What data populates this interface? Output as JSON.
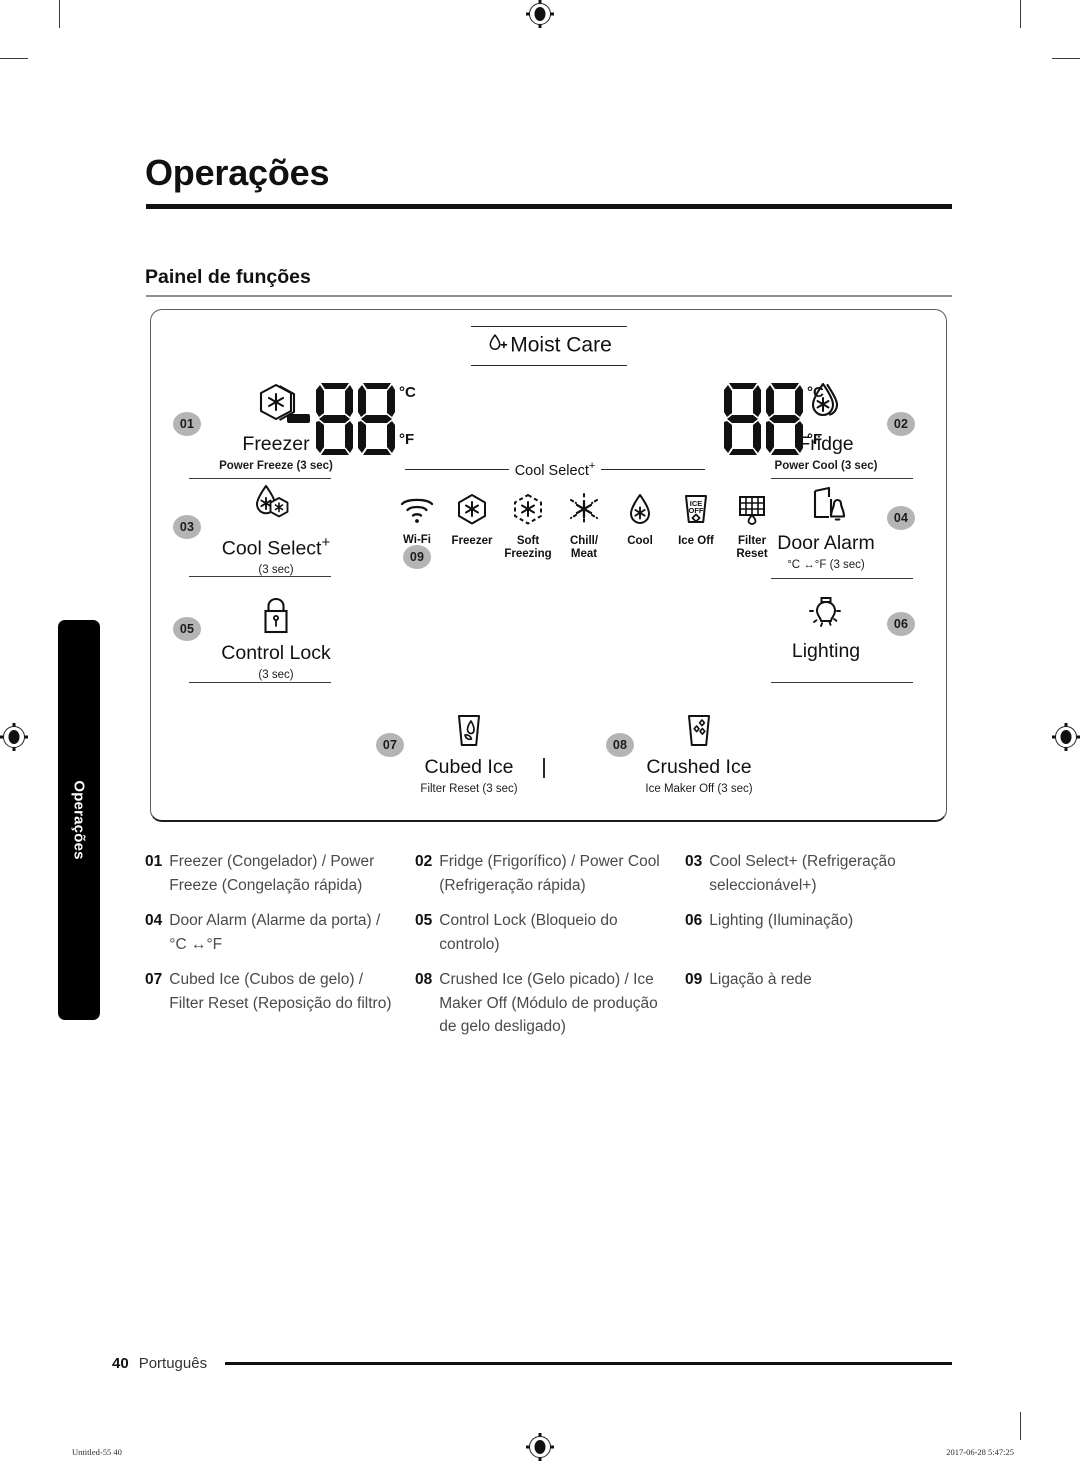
{
  "document": {
    "chapter_title": "Operações",
    "section_title": "Painel de funções",
    "side_tab_label": "Operações"
  },
  "panel": {
    "moist_care": {
      "label": "Moist Care",
      "icon": "water-drop-plus-icon"
    },
    "displays": [
      {
        "name": "freezer-temperature-display",
        "value": "88",
        "minus": "−",
        "unit_top": "°C",
        "unit_bottom": "°F"
      },
      {
        "name": "fridge-temperature-display",
        "value": "88",
        "minus": "",
        "unit_top": "°C",
        "unit_bottom": "°F"
      }
    ],
    "buttons": [
      {
        "id": "01",
        "name": "freezer-button",
        "icon": "hexagon-snowflake-icon",
        "title": "Freezer",
        "sub": "Power Freeze (3 sec)"
      },
      {
        "id": "02",
        "name": "fridge-button",
        "icon": "droplet-snowflake-icon",
        "title": "Fridge",
        "sub": "Power Cool (3 sec)"
      },
      {
        "id": "03",
        "name": "cool-select-plus-button",
        "icon": "droplet-snowflake-hexagon-icon",
        "title": "Cool Select",
        "title_sup": "+",
        "sub": "(3 sec)"
      },
      {
        "id": "04",
        "name": "door-alarm-button",
        "icon": "door-bell-icon",
        "title": "Door Alarm",
        "sub": "°C ↔°F (3 sec)"
      },
      {
        "id": "05",
        "name": "control-lock-button",
        "icon": "padlock-icon",
        "title": "Control Lock",
        "sub": "(3 sec)"
      },
      {
        "id": "06",
        "name": "lighting-button",
        "icon": "light-bulb-icon",
        "title": "Lighting",
        "sub": ""
      },
      {
        "id": "07",
        "name": "cubed-ice-button",
        "icon": "glass-cubed-ice-icon",
        "title": "Cubed Ice",
        "sub": "Filter Reset (3 sec)"
      },
      {
        "id": "08",
        "name": "crushed-ice-button",
        "icon": "glass-crushed-ice-icon",
        "title": "Crushed Ice",
        "sub": "Ice Maker Off (3 sec)"
      }
    ],
    "cool_select_strip": {
      "header_label": "Cool Select",
      "header_sup": "+",
      "items": [
        {
          "name": "wifi-indicator",
          "icon": "wifi-icon",
          "label": "Wi-Fi",
          "badge": "09"
        },
        {
          "name": "freezer-indicator",
          "icon": "hexagon-snowflake-icon",
          "label": "Freezer",
          "badge": ""
        },
        {
          "name": "soft-freezing-indicator",
          "icon": "dashed-hexagon-snowflake-icon",
          "label": "Soft\nFreezing",
          "badge": ""
        },
        {
          "name": "chill-meat-indicator",
          "icon": "dashed-snowflake-icon",
          "label": "Chill/\nMeat",
          "badge": ""
        },
        {
          "name": "cool-indicator",
          "icon": "droplet-snowflake-icon",
          "label": "Cool",
          "badge": ""
        },
        {
          "name": "ice-off-indicator",
          "icon": "glass-ice-off-icon",
          "label": "Ice Off",
          "badge": ""
        },
        {
          "name": "filter-reset-indicator",
          "icon": "filter-grid-drop-icon",
          "label": "Filter\nReset",
          "badge": ""
        }
      ]
    }
  },
  "legend": [
    {
      "num": "01",
      "text": "Freezer (Congelador) / Power Freeze (Congelação rápida)"
    },
    {
      "num": "02",
      "text": "Fridge (Frigorífico) / Power Cool (Refrigeração rápida)"
    },
    {
      "num": "03",
      "text": "Cool Select+ (Refrigeração seleccionável+)"
    },
    {
      "num": "04",
      "text": "Door Alarm (Alarme da porta) / °C ↔°F"
    },
    {
      "num": "05",
      "text": "Control Lock (Bloqueio do controlo)"
    },
    {
      "num": "06",
      "text": "Lighting (Iluminação)"
    },
    {
      "num": "07",
      "text": "Cubed Ice (Cubos de gelo) / Filter Reset (Reposição do filtro)"
    },
    {
      "num": "08",
      "text": "Crushed Ice (Gelo picado) / Ice Maker Off (Módulo de produção de gelo desligado)"
    },
    {
      "num": "09",
      "text": "Ligação à rede"
    }
  ],
  "footer": {
    "page_number": "40",
    "language": "Português",
    "print_left": "Untitled-55   40",
    "print_right": "2017-06-28   5:47:25"
  }
}
